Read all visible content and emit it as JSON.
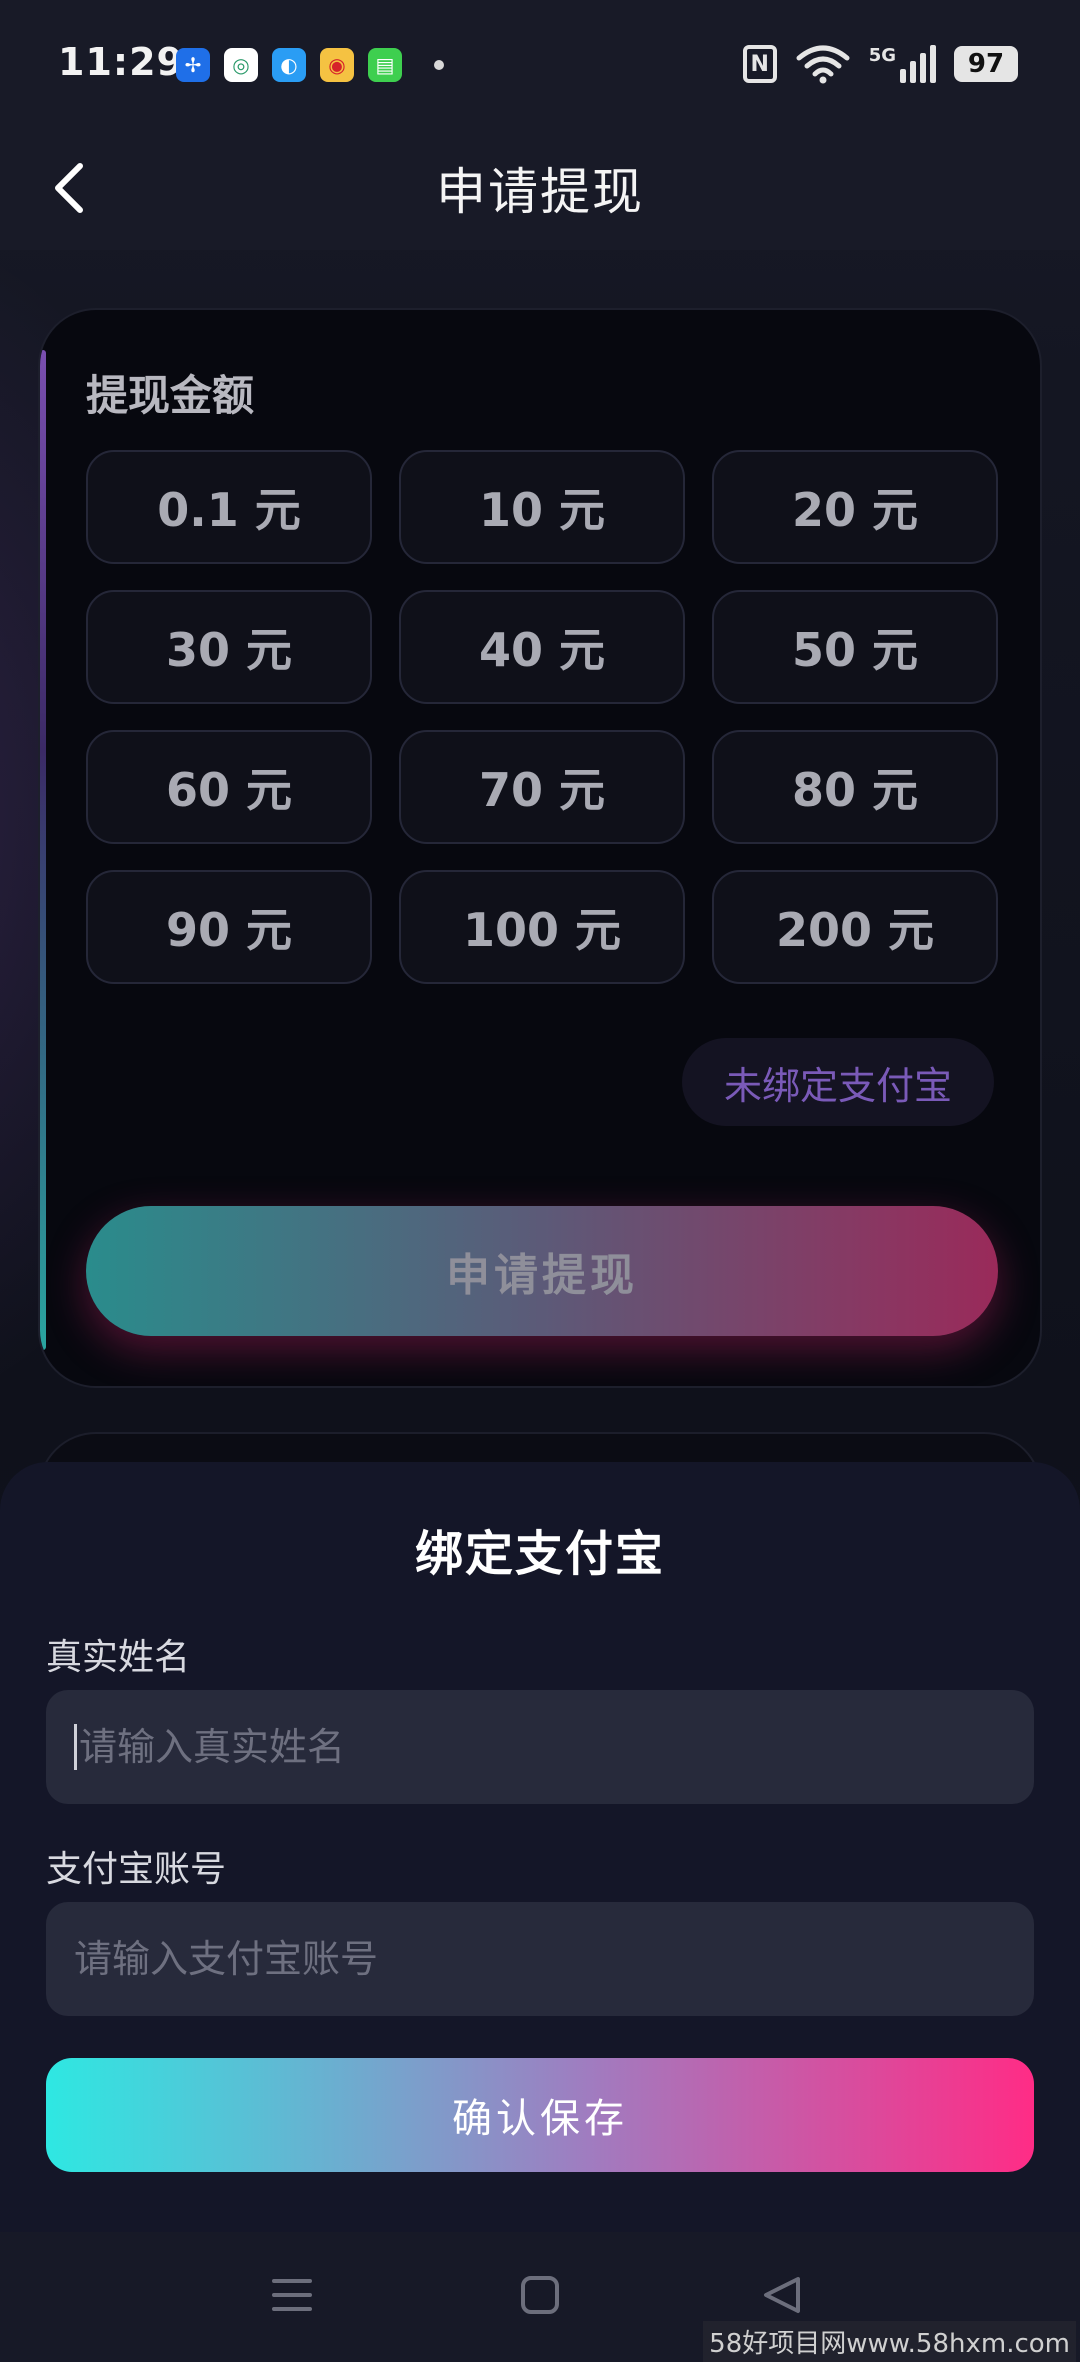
{
  "status_bar": {
    "time": "11:29",
    "battery": "97",
    "network": "5G",
    "apps": [
      {
        "icon": "fan-app-icon",
        "color": "#1f6fe8",
        "glyph": "✢"
      },
      {
        "icon": "mobile-carrier-app-icon",
        "color": "#ffffff",
        "glyph": "◎"
      },
      {
        "icon": "cloud-app-icon",
        "color": "#2a9df4",
        "glyph": "◐"
      },
      {
        "icon": "weibo-app-icon",
        "color": "#f5c242",
        "glyph": "◉"
      },
      {
        "icon": "message-app-icon",
        "color": "#3ecf4f",
        "glyph": "▤"
      }
    ]
  },
  "header": {
    "title": "申请提现"
  },
  "withdraw": {
    "section_title": "提现金额",
    "amounts": [
      "0.1 元",
      "10 元",
      "20 元",
      "30 元",
      "40 元",
      "50 元",
      "60 元",
      "70 元",
      "80 元",
      "90 元",
      "100 元",
      "200 元"
    ],
    "unbound_label": "未绑定支付宝",
    "apply_button": "申请提现"
  },
  "bind_sheet": {
    "title": "绑定支付宝",
    "name_label": "真实姓名",
    "name_placeholder": "请输入真实姓名",
    "account_label": "支付宝账号",
    "account_placeholder": "请输入支付宝账号",
    "save_button": "确认保存"
  },
  "watermark": "58好项目网www.58hxm.com"
}
